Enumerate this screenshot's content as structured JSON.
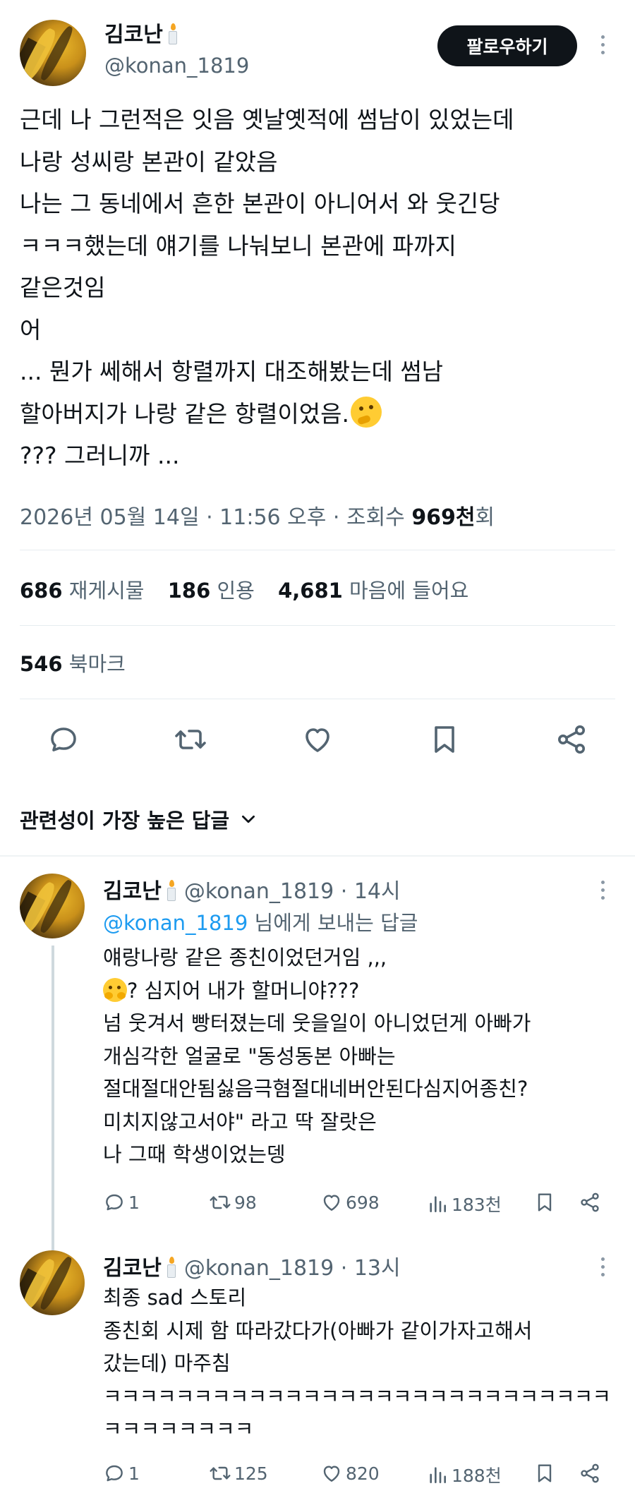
{
  "main_tweet": {
    "author_name": "김코난",
    "handle": "@konan_1819",
    "follow_label": "팔로우하기",
    "lines": [
      "근데 나 그런적은 잇음 옛날옛적에 썸남이 있었는데",
      "나랑 성씨랑 본관이 같았음",
      "나는 그 동네에서 흔한 본관이 아니어서 와 웃긴당",
      "ㅋㅋㅋ했는데 얘기를 나눠보니 본관에 파까지",
      "같은것임",
      "어",
      "... 뭔가 쎄해서 항렬까지 대조해봤는데 썸남",
      "할아버지가 나랑 같은 항렬이었음.",
      "??? 그러니까 ..."
    ],
    "line8_emoji": "thinking-face-emoji",
    "meta_prefix": "2026년 05월 14일 · 11:56 오후 · 조회수 ",
    "views_value": "969천",
    "views_suffix": "회"
  },
  "stats": {
    "retweets_count": "686",
    "retweets_label": "재게시물",
    "quotes_count": "186",
    "quotes_label": "인용",
    "likes_count": "4,681",
    "likes_label": "마음에 들어요",
    "bookmarks_count": "546",
    "bookmarks_label": "북마크"
  },
  "sort_label": "관련성이 가장 높은 답글",
  "replies": [
    {
      "author_name": "김코난",
      "meta": "@konan_1819 · 14시",
      "reply_to_mention": "@konan_1819",
      "reply_to_suffix": " 님에게 보내는 답글",
      "lines": [
        "얘랑나랑 같은 종친이었던거임 ,,,",
        "? 심지어 내가 할머니야???",
        "넘 웃겨서 빵터졌는데 웃을일이 아니었던게 아빠가",
        "개심각한 얼굴로 \"동성동본 아빠는",
        "절대절대안됨싫음극혐절대네버안된다심지어종친?",
        "미치지않고서야\" 라고 딱 잘랏은",
        "나 그때 학생이었는뎅"
      ],
      "line2_emoji": "hugging-face-emoji",
      "replies_count": "1",
      "retweets_count": "98",
      "likes_count": "698",
      "views_count": "183천"
    },
    {
      "author_name": "김코난",
      "meta": "@konan_1819 · 13시",
      "lines": [
        "최종 sad 스토리",
        "종친회 시제 함 따라갔다가(아빠가 같이가자고해서",
        "갔는데) 마주침",
        "ㅋㅋㅋㅋㅋㅋㅋㅋㅋㅋㅋㅋㅋㅋㅋㅋㅋㅋㅋㅋㅋㅋㅋㅋㅋㅋㅋㅋ",
        "ㅋㅋㅋㅋㅋㅋㅋㅋ"
      ],
      "replies_count": "1",
      "retweets_count": "125",
      "likes_count": "820",
      "views_count": "188천"
    }
  ],
  "colors": {
    "text": "#0f1419",
    "secondary": "#536471",
    "link": "#1d9bf0",
    "follow_button_bg": "#0f1419"
  },
  "icons": [
    "reply-icon",
    "retweet-icon",
    "like-icon",
    "bookmark-icon",
    "share-icon",
    "views-icon",
    "more-icon",
    "chevron-down-icon",
    "candle-emoji"
  ]
}
